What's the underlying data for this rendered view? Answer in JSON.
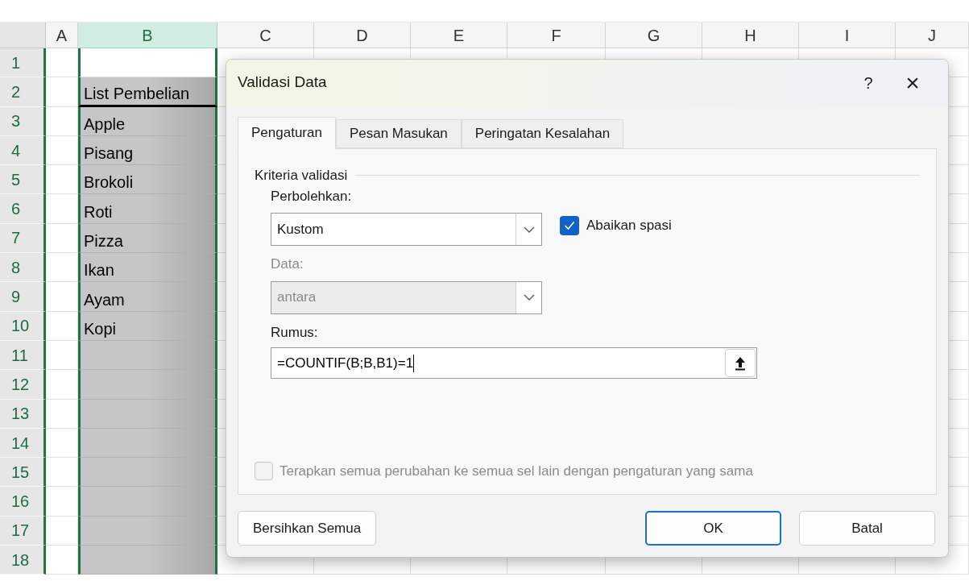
{
  "sheet": {
    "columns": [
      {
        "label": "A",
        "selected": false
      },
      {
        "label": "B",
        "selected": true
      },
      {
        "label": "C",
        "selected": false
      },
      {
        "label": "D",
        "selected": false
      },
      {
        "label": "E",
        "selected": false
      },
      {
        "label": "F",
        "selected": false
      },
      {
        "label": "G",
        "selected": false
      },
      {
        "label": "H",
        "selected": false
      },
      {
        "label": "I",
        "selected": false
      },
      {
        "label": "J",
        "selected": false
      }
    ],
    "rows": [
      {
        "label": "1"
      },
      {
        "label": "2",
        "b": "List Pembelian",
        "kind": "header"
      },
      {
        "label": "3",
        "b": "Apple"
      },
      {
        "label": "4",
        "b": "Pisang"
      },
      {
        "label": "5",
        "b": "Brokoli"
      },
      {
        "label": "6",
        "b": "Roti"
      },
      {
        "label": "7",
        "b": "Pizza"
      },
      {
        "label": "8",
        "b": "Ikan"
      },
      {
        "label": "9",
        "b": "Ayam"
      },
      {
        "label": "10",
        "b": "Kopi"
      },
      {
        "label": "11"
      },
      {
        "label": "12"
      },
      {
        "label": "13"
      },
      {
        "label": "14"
      },
      {
        "label": "15"
      },
      {
        "label": "16"
      },
      {
        "label": "17"
      },
      {
        "label": "18"
      }
    ]
  },
  "dialog": {
    "title": "Validasi Data",
    "help": "?",
    "close": "×",
    "tabs": [
      {
        "label": "Pengaturan",
        "selected": true
      },
      {
        "label": "Pesan Masukan",
        "selected": false
      },
      {
        "label": "Peringatan Kesalahan",
        "selected": false
      }
    ],
    "group_title": "Kriteria validasi",
    "allow": {
      "label": "Perbolehkan:",
      "value": "Kustom",
      "disabled": false
    },
    "ignore_blank": {
      "label": "Abaikan spasi",
      "checked": true
    },
    "data": {
      "label": "Data:",
      "value": "antara",
      "disabled": true
    },
    "formula": {
      "label": "Rumus:",
      "value": "=COUNTIF(B;B,B1)=1"
    },
    "apply_all": {
      "label": "Terapkan semua perubahan ke semua sel lain dengan pengaturan yang sama",
      "checked": false,
      "disabled": true
    },
    "buttons": [
      {
        "label": "Bersihkan Semua",
        "kind": "secondary"
      },
      {
        "label": "OK",
        "kind": "default"
      },
      {
        "label": "Batal",
        "kind": "secondary"
      }
    ]
  }
}
